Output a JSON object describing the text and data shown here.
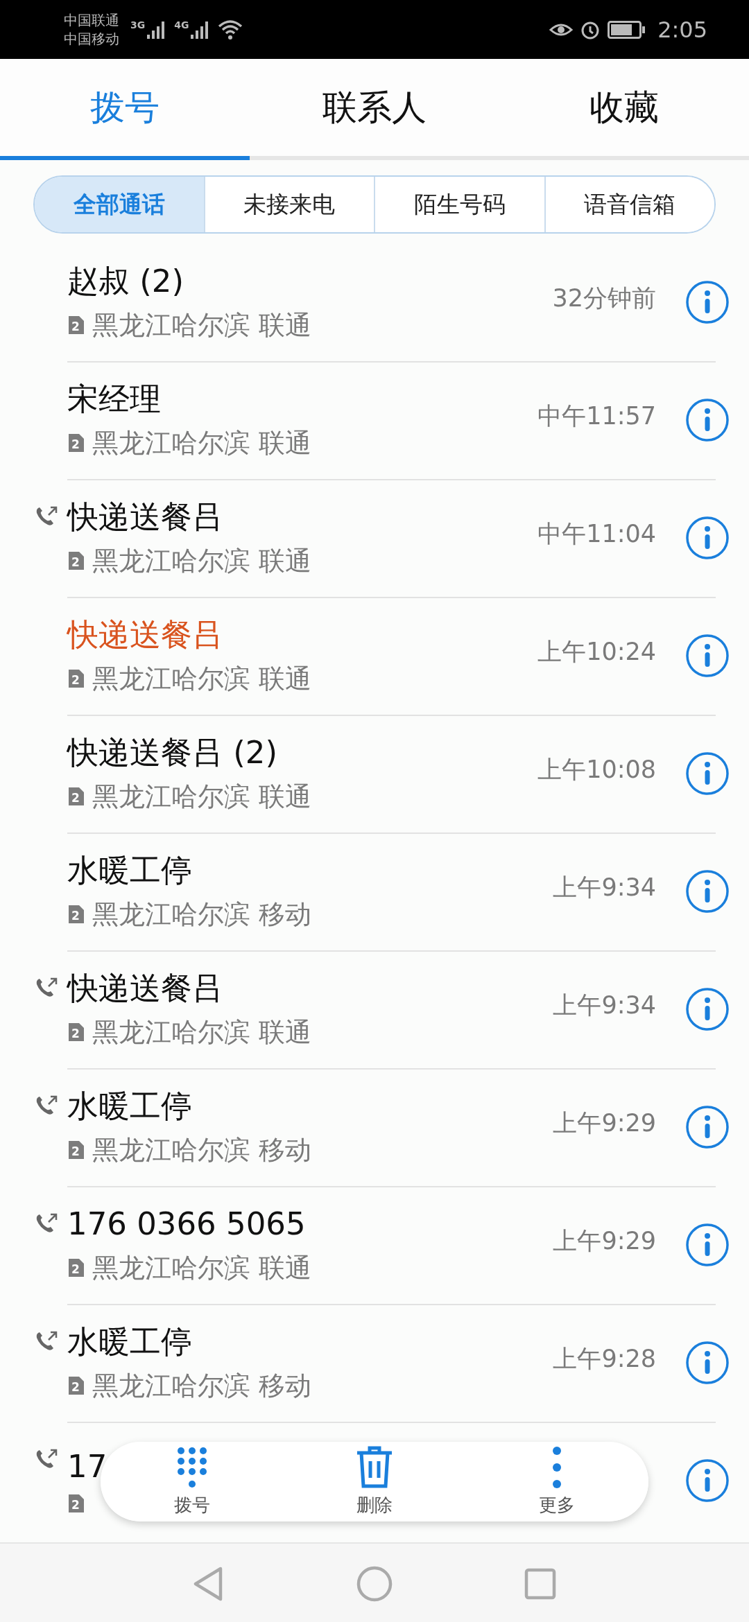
{
  "status_bar": {
    "carriers": [
      "中国联通",
      "中国移动"
    ],
    "network_labels": [
      "3G",
      "4G"
    ],
    "time": "2:05"
  },
  "tabs": [
    {
      "label": "拨号",
      "selected": true
    },
    {
      "label": "联系人",
      "selected": false
    },
    {
      "label": "收藏",
      "selected": false
    }
  ],
  "filters": [
    {
      "label": "全部通话",
      "selected": true
    },
    {
      "label": "未接来电",
      "selected": false
    },
    {
      "label": "陌生号码",
      "selected": false
    },
    {
      "label": "语音信箱",
      "selected": false
    }
  ],
  "calls": [
    {
      "name": "赵叔 (2)",
      "sim": "2",
      "location": "黑龙江哈尔滨 联通",
      "time": "32分钟前",
      "outgoing": false,
      "missed": false
    },
    {
      "name": "宋经理",
      "sim": "2",
      "location": "黑龙江哈尔滨 联通",
      "time": "中午11:57",
      "outgoing": false,
      "missed": false
    },
    {
      "name": "快递送餐吕",
      "sim": "2",
      "location": "黑龙江哈尔滨 联通",
      "time": "中午11:04",
      "outgoing": true,
      "missed": false
    },
    {
      "name": "快递送餐吕",
      "sim": "2",
      "location": "黑龙江哈尔滨 联通",
      "time": "上午10:24",
      "outgoing": false,
      "missed": true
    },
    {
      "name": "快递送餐吕 (2)",
      "sim": "2",
      "location": "黑龙江哈尔滨 联通",
      "time": "上午10:08",
      "outgoing": false,
      "missed": false
    },
    {
      "name": "水暖工停",
      "sim": "2",
      "location": "黑龙江哈尔滨 移动",
      "time": "上午9:34",
      "outgoing": false,
      "missed": false
    },
    {
      "name": "快递送餐吕",
      "sim": "2",
      "location": "黑龙江哈尔滨 联通",
      "time": "上午9:34",
      "outgoing": true,
      "missed": false
    },
    {
      "name": "水暖工停",
      "sim": "2",
      "location": "黑龙江哈尔滨 移动",
      "time": "上午9:29",
      "outgoing": true,
      "missed": false
    },
    {
      "name": "176 0366 5065",
      "sim": "2",
      "location": "黑龙江哈尔滨 联通",
      "time": "上午9:29",
      "outgoing": true,
      "missed": false
    },
    {
      "name": "水暖工停",
      "sim": "2",
      "location": "黑龙江哈尔滨 移动",
      "time": "上午9:28",
      "outgoing": true,
      "missed": false
    },
    {
      "name": "17",
      "sim": "2",
      "outgoing": true,
      "missed": false
    }
  ],
  "actions": [
    {
      "kind": "dialpad",
      "label": "拨号"
    },
    {
      "kind": "delete",
      "label": "删除"
    },
    {
      "kind": "more",
      "label": "更多"
    }
  ]
}
